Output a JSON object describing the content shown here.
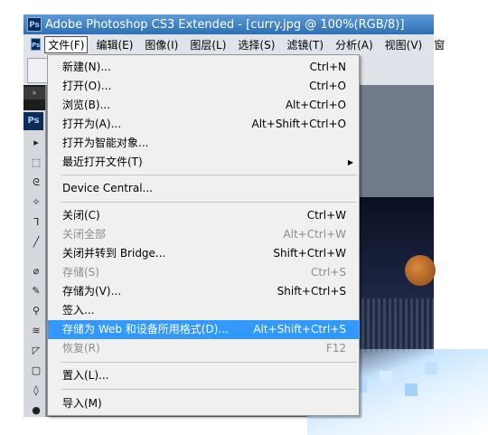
{
  "window": {
    "title": "Adobe Photoshop CS3 Extended - [curry.jpg @ 100%(RGB/8)]",
    "app_icon": "Ps"
  },
  "menubar": {
    "icon": "Ps",
    "items": [
      "文件(F)",
      "编辑(E)",
      "图像(I)",
      "图层(L)",
      "选择(S)",
      "滤镜(T)",
      "分析(A)",
      "视图(V)",
      "窗"
    ]
  },
  "toolbox": {
    "badge": "Ps",
    "tab": "»"
  },
  "file_menu": {
    "items": [
      {
        "label": "新建(N)...",
        "shortcut": "Ctrl+N"
      },
      {
        "label": "打开(O)...",
        "shortcut": "Ctrl+O"
      },
      {
        "label": "浏览(B)...",
        "shortcut": "Alt+Ctrl+O"
      },
      {
        "label": "打开为(A)...",
        "shortcut": "Alt+Shift+Ctrl+O"
      },
      {
        "label": "打开为智能对象...",
        "shortcut": ""
      },
      {
        "label": "最近打开文件(T)",
        "shortcut": "",
        "submenu_arrow": "▶"
      },
      {
        "label": "Device Central...",
        "shortcut": ""
      },
      {
        "label": "关闭(C)",
        "shortcut": "Ctrl+W"
      },
      {
        "label": "关闭全部",
        "shortcut": "Alt+Ctrl+W"
      },
      {
        "label": "关闭并转到 Bridge...",
        "shortcut": "Shift+Ctrl+W"
      },
      {
        "label": "存储(S)",
        "shortcut": "Ctrl+S"
      },
      {
        "label": "存储为(V)...",
        "shortcut": "Shift+Ctrl+S"
      },
      {
        "label": "签入...",
        "shortcut": ""
      },
      {
        "label": "存储为 Web 和设备所用格式(D)...",
        "shortcut": "Alt+Shift+Ctrl+S"
      },
      {
        "label": "恢复(R)",
        "shortcut": "F12"
      },
      {
        "label": "置入(L)...",
        "shortcut": ""
      },
      {
        "label": "导入(M)",
        "shortcut": ""
      }
    ]
  },
  "colors": {
    "highlight": "#3399ff",
    "menu_bg": "#f0f0f0",
    "disabled_text": "#8d8d8d",
    "titlebar": "#3a82c8"
  }
}
